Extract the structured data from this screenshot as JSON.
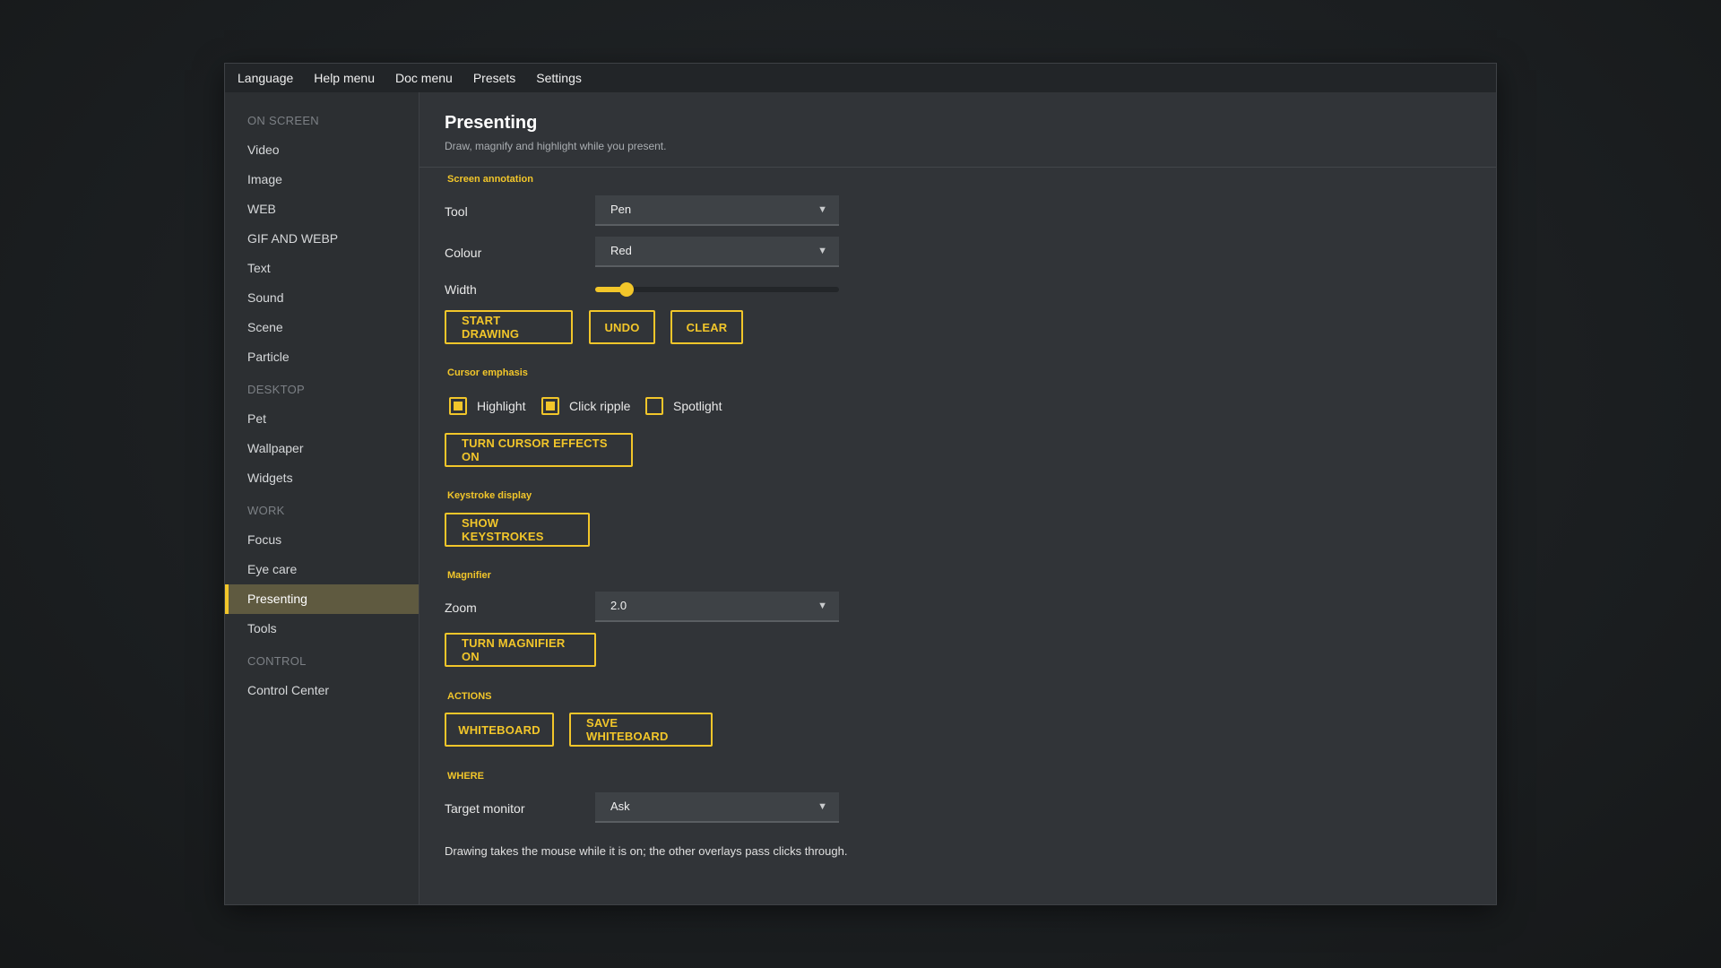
{
  "menu": [
    "Language",
    "Help menu",
    "Doc menu",
    "Presets",
    "Settings"
  ],
  "sidebar": {
    "sections": [
      {
        "title": "ON SCREEN",
        "items": [
          "Video",
          "Image",
          "WEB",
          "GIF AND WEBP",
          "Text",
          "Sound",
          "Scene",
          "Particle"
        ]
      },
      {
        "title": "DESKTOP",
        "items": [
          "Pet",
          "Wallpaper",
          "Widgets"
        ]
      },
      {
        "title": "WORK",
        "items": [
          "Focus",
          "Eye care",
          "Presenting",
          "Tools"
        ]
      },
      {
        "title": "CONTROL",
        "items": [
          "Control Center"
        ]
      }
    ],
    "active": "Presenting"
  },
  "header": {
    "title": "Presenting",
    "subtitle": "Draw, magnify and highlight while you present."
  },
  "annotation": {
    "section": "Screen annotation",
    "tool_label": "Tool",
    "tool_value": "Pen",
    "colour_label": "Colour",
    "colour_value": "Red",
    "width_label": "Width",
    "width_fraction": 0.1,
    "start_label": "START DRAWING",
    "undo_label": "UNDO",
    "clear_label": "CLEAR"
  },
  "cursor": {
    "section": "Cursor emphasis",
    "highlight_label": "Highlight",
    "highlight_checked": true,
    "ripple_label": "Click ripple",
    "ripple_checked": true,
    "spotlight_label": "Spotlight",
    "spotlight_checked": false,
    "toggle_label": "TURN CURSOR EFFECTS ON"
  },
  "keystroke": {
    "section": "Keystroke display",
    "show_label": "SHOW KEYSTROKES"
  },
  "magnifier": {
    "section": "Magnifier",
    "zoom_label": "Zoom",
    "zoom_value": "2.0",
    "toggle_label": "TURN MAGNIFIER ON"
  },
  "actions": {
    "section": "ACTIONS",
    "whiteboard_label": "WHITEBOARD",
    "save_label": "SAVE WHITEBOARD"
  },
  "where": {
    "section": "WHERE",
    "monitor_label": "Target monitor",
    "monitor_value": "Ask"
  },
  "footnote": "Drawing takes the mouse while it is on; the other overlays pass clicks through.",
  "colors": {
    "accent": "#f2c62a",
    "window_bg": "#313438",
    "sidebar_bg": "#2c2f32"
  }
}
